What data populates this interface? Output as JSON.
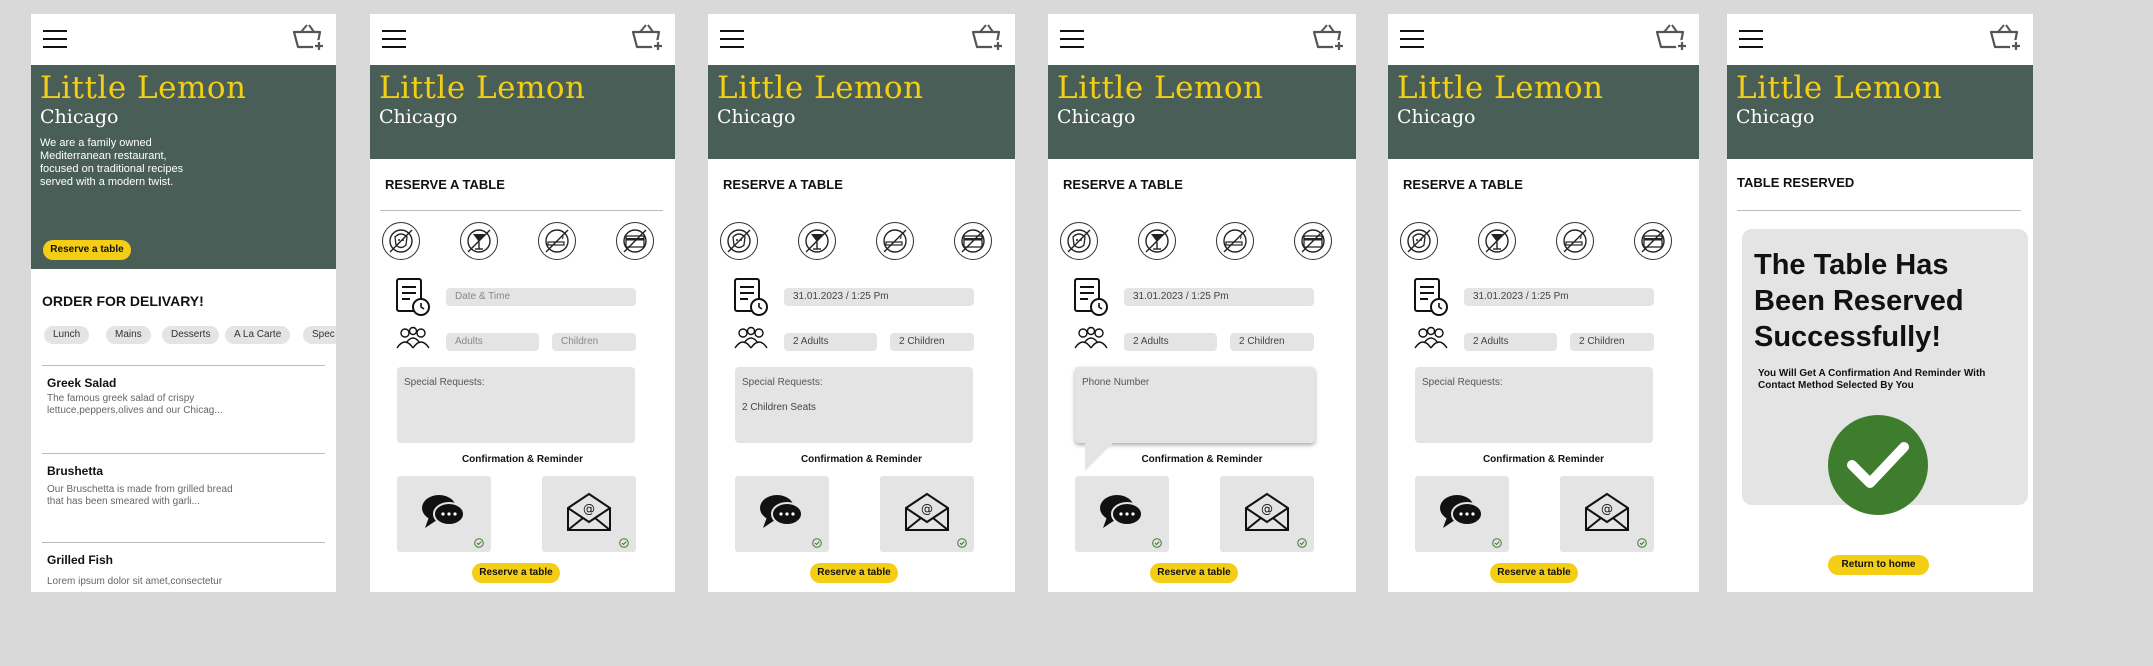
{
  "brand": {
    "title": "Little Lemon",
    "city": "Chicago",
    "colors": {
      "green": "#495e57",
      "yellow": "#f4ce14",
      "check_green": "#3f7d2e"
    }
  },
  "home": {
    "description": "We are a family owned Mediterranean restaurant, focused on traditional recipes served with a modern twist.",
    "reserve_button": "Reserve a table",
    "order_title": "ORDER FOR DELIVARY!",
    "categories": [
      "Lunch",
      "Mains",
      "Desserts",
      "A La Carte",
      "Spec"
    ],
    "dishes": [
      {
        "name": "Greek Salad",
        "desc": "The famous greek salad of crispy lettuce,peppers,olives and our Chicag..."
      },
      {
        "name": "Brushetta",
        "desc": "Our Bruschetta is made from grilled bread that has been smeared with garli..."
      },
      {
        "name": "Grilled Fish",
        "desc": "Lorem ipsum dolor sit amet,consectetur"
      }
    ]
  },
  "reserve": {
    "title": "RESERVE A TABLE",
    "icons": [
      "no-pets-icon",
      "no-alcohol-icon",
      "no-smoking-icon",
      "no-card-icon"
    ],
    "date_placeholder": "Date & Time",
    "date_value": "31.01.2023 / 1:25 Pm",
    "adults_placeholder": "Adults",
    "children_placeholder": "Children",
    "adults_value": "2 Adults",
    "children_value": "2 Children",
    "special_label": "Special Requests:",
    "special_value": "2 Children Seats",
    "phone_label": "Phone Number",
    "confirmation_label": "Confirmation & Reminder",
    "methods": [
      "chat-icon",
      "email-icon"
    ],
    "button": "Reserve a table"
  },
  "success": {
    "title": "TABLE RESERVED",
    "headline": "The Table Has Been Reserved Successfully!",
    "subtext": "You Will Get A Confirmation And Reminder With Contact Method Selected By You",
    "button": "Return to home"
  }
}
